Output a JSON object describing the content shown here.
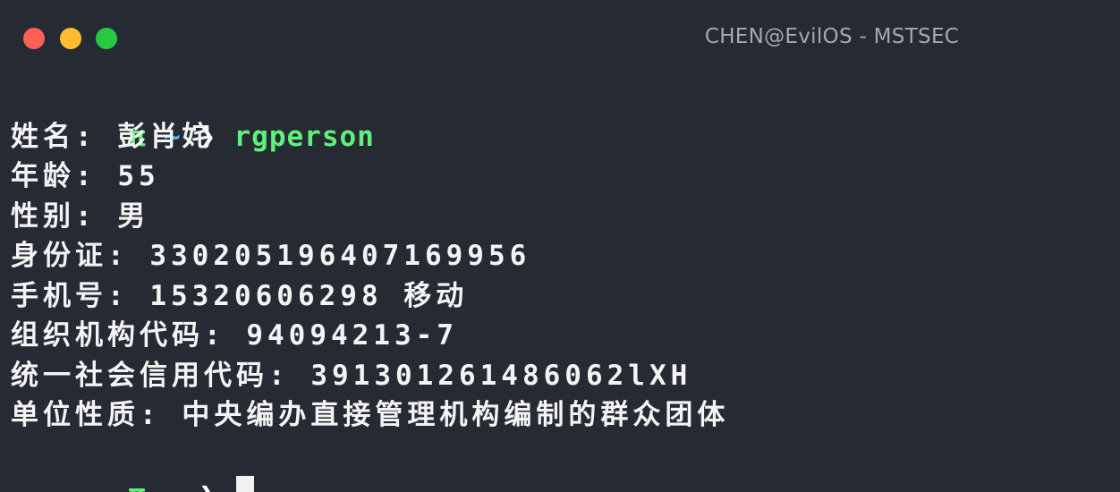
{
  "window": {
    "title": "CHEN@EvilOS - MSTSEC",
    "controls": [
      "close",
      "minimize",
      "maximize"
    ]
  },
  "prompt": {
    "symbol": "π",
    "path": "~",
    "arrow": "❯"
  },
  "command": "rgperson",
  "output": [
    "姓名: 彭肖姹",
    "年龄: 55",
    "性别: 男",
    "身份证: 330205196407169956",
    "手机号: 15320606298 移动",
    "组织机构代码: 94094213-7",
    "统一社会信用代码: 391301261486062lXH",
    "单位性质: 中央编办直接管理机构编制的群众团体"
  ],
  "colors": {
    "background": "#262a33",
    "prompt_green": "#5ff17c",
    "prompt_blue": "#58b8f6",
    "text": "#f4f4f4",
    "title": "#a4a8b2"
  }
}
